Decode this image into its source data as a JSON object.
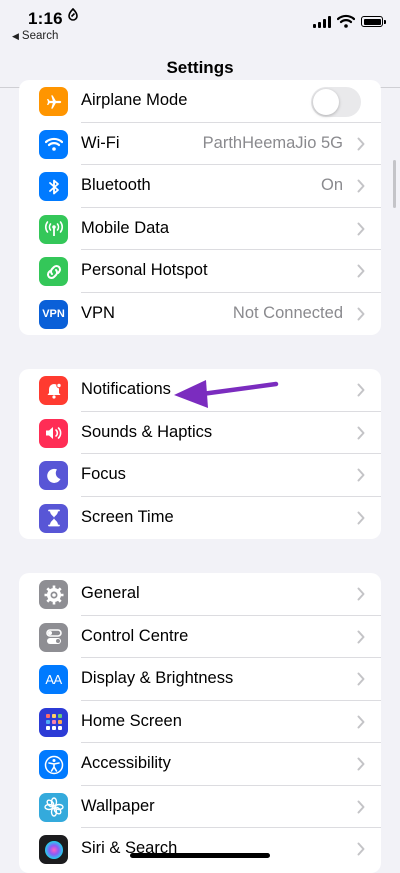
{
  "status": {
    "time": "1:16",
    "back_label": "Search"
  },
  "nav": {
    "title": "Settings"
  },
  "groups": [
    {
      "rows": [
        {
          "label": "Airplane Mode",
          "value": "",
          "icon": "airplane-icon",
          "color": "#ff9500",
          "toggle": true,
          "toggle_on": false
        },
        {
          "label": "Wi-Fi",
          "value": "ParthHeemaJio 5G",
          "icon": "wifi-icon",
          "color": "#007aff"
        },
        {
          "label": "Bluetooth",
          "value": "On",
          "icon": "bluetooth-icon",
          "color": "#007aff"
        },
        {
          "label": "Mobile Data",
          "value": "",
          "icon": "antenna-icon",
          "color": "#34c759"
        },
        {
          "label": "Personal Hotspot",
          "value": "",
          "icon": "hotspot-icon",
          "color": "#34c759"
        },
        {
          "label": "VPN",
          "value": "Not Connected",
          "icon": "vpn-icon",
          "icon_text": "VPN",
          "color": "#0a60d8"
        }
      ]
    },
    {
      "rows": [
        {
          "label": "Notifications",
          "icon": "bell-icon",
          "color": "#ff3b30"
        },
        {
          "label": "Sounds & Haptics",
          "icon": "speaker-icon",
          "color": "#ff2d55"
        },
        {
          "label": "Focus",
          "icon": "moon-icon",
          "color": "#5856d6"
        },
        {
          "label": "Screen Time",
          "icon": "hourglass-icon",
          "color": "#5856d6"
        }
      ]
    },
    {
      "rows": [
        {
          "label": "General",
          "icon": "gear-icon",
          "color": "#8e8e93"
        },
        {
          "label": "Control Centre",
          "icon": "switches-icon",
          "color": "#8e8e93"
        },
        {
          "label": "Display & Brightness",
          "icon": "text-size-icon",
          "icon_text": "AA",
          "color": "#007aff"
        },
        {
          "label": "Home Screen",
          "icon": "grid-icon",
          "color": "#2c3bd6"
        },
        {
          "label": "Accessibility",
          "icon": "accessibility-icon",
          "color": "#007aff"
        },
        {
          "label": "Wallpaper",
          "icon": "flower-icon",
          "color": "#34aadc"
        },
        {
          "label": "Siri & Search",
          "icon": "siri-icon",
          "color": "#1c1c1e"
        }
      ]
    }
  ],
  "annotation": {
    "arrow_color": "#7b2cbf",
    "points_to": "Notifications"
  }
}
